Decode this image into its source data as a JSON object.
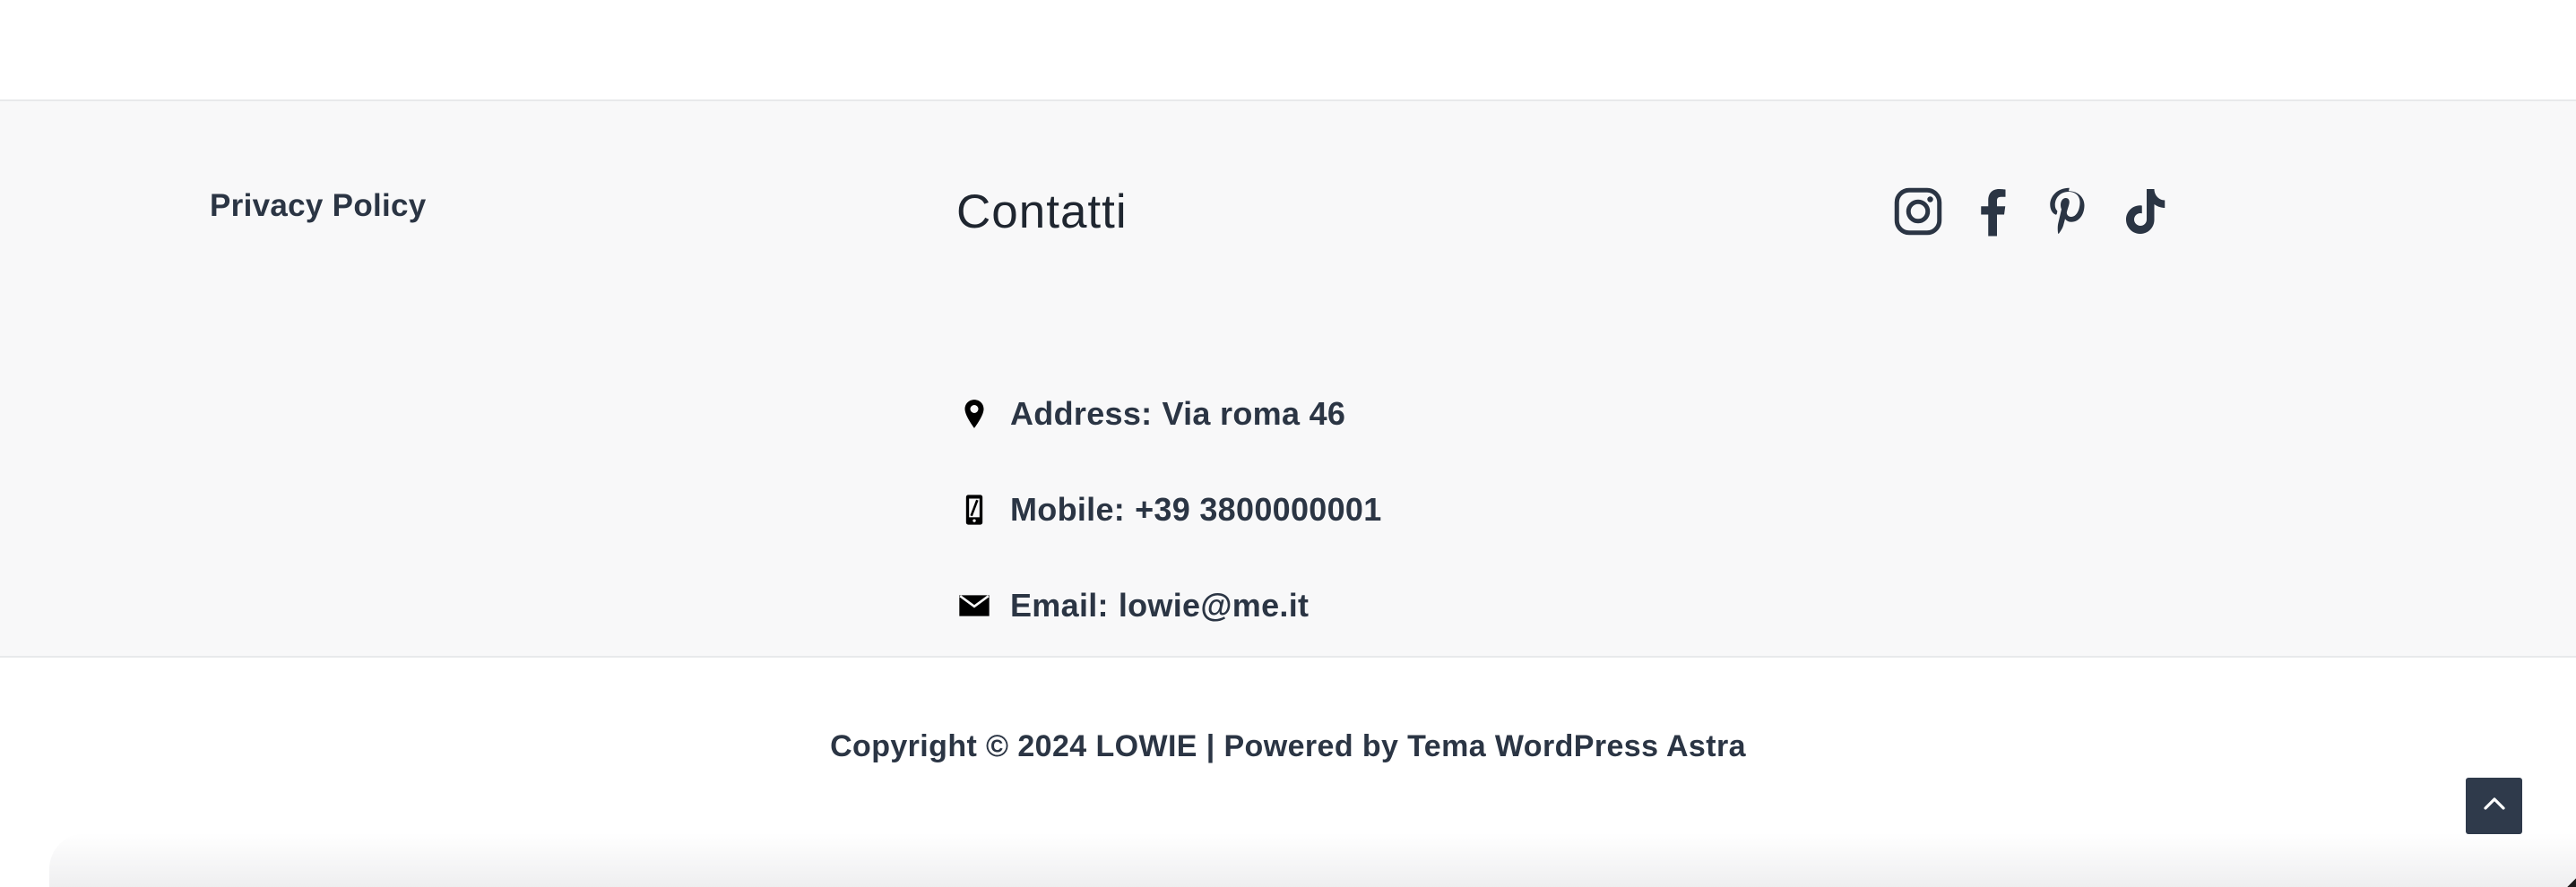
{
  "footer": {
    "privacy_link": "Privacy Policy",
    "contact_title": "Contatti",
    "contacts": [
      {
        "icon": "map-pin-icon",
        "label": "Address:",
        "value": "Via roma 46"
      },
      {
        "icon": "mobile-phone-icon",
        "label": "Mobile:",
        "value": "+39 3800000001"
      },
      {
        "icon": "envelope-icon",
        "label": "Email:",
        "value": "lowie@me.it"
      }
    ],
    "social_icons": [
      "instagram-icon",
      "facebook-icon",
      "pinterest-icon",
      "tiktok-icon"
    ]
  },
  "bottom": {
    "copyright": "Copyright © 2024 LOWIE | Powered by Tema WordPress Astra",
    "scroll_top_icon": "chevron-up-icon"
  },
  "colors": {
    "text": "#2b3544",
    "footer_bg": "#f8f8f9",
    "scroll_button_bg": "#2f3a4b"
  }
}
